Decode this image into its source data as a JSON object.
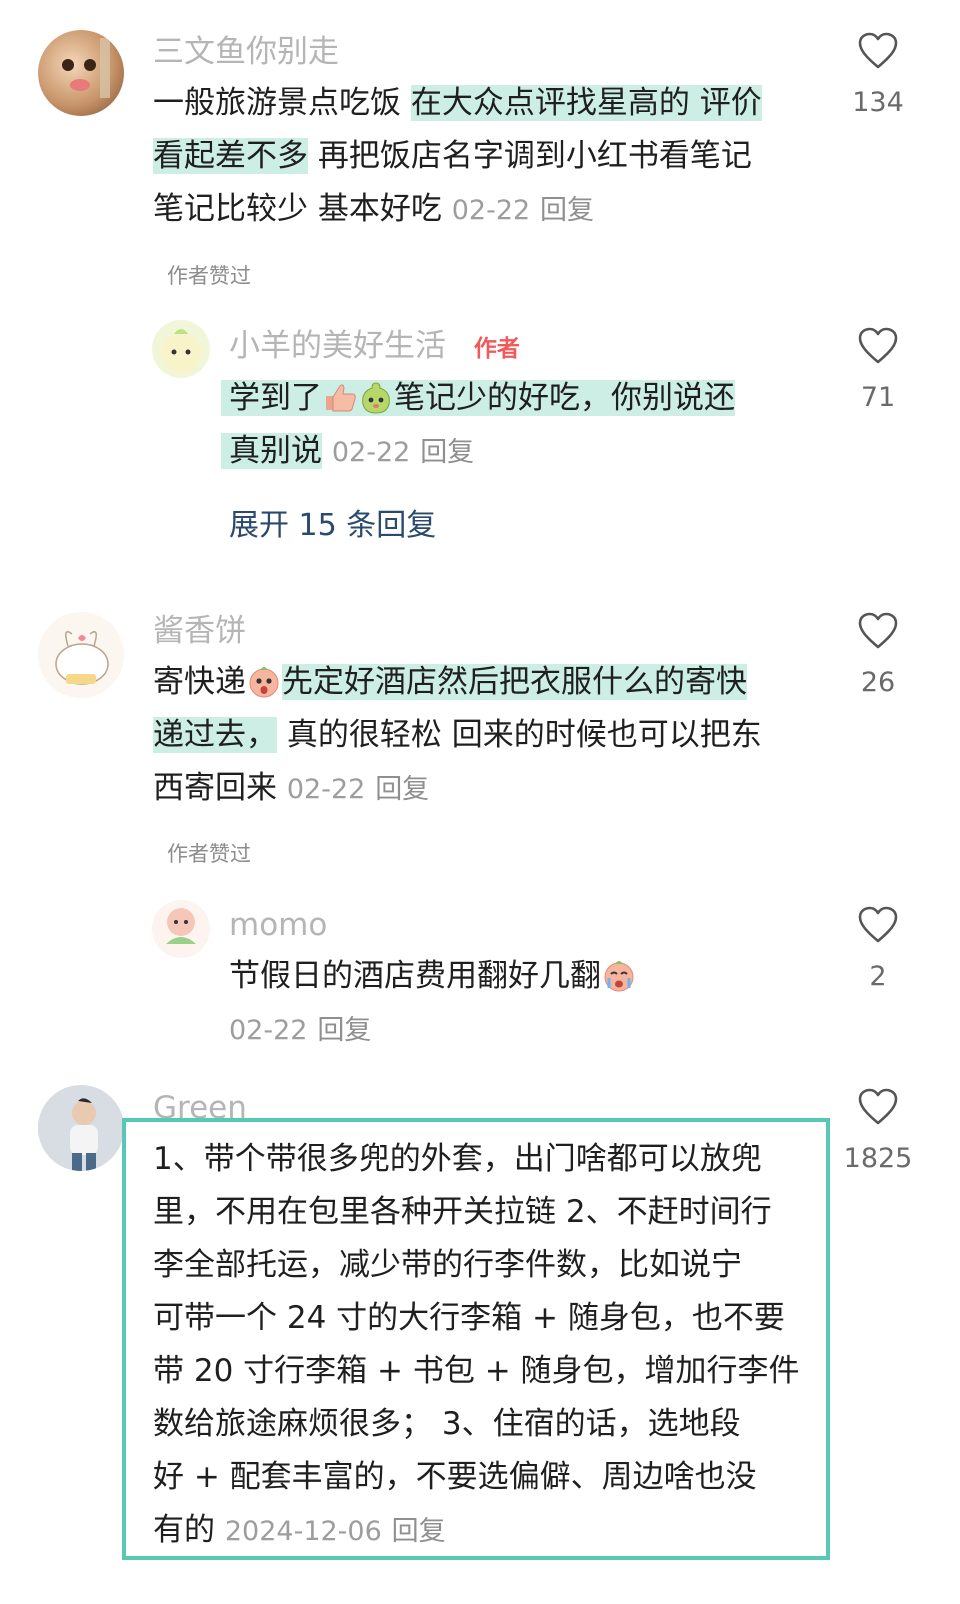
{
  "comments": [
    {
      "user": "三文鱼你别走",
      "text_parts": [
        "一般旅游景点吃饭 ",
        "在大众点评找星高的 评价看起差不多",
        " 再把饭店名字调到小红书看笔记笔记比较少 基本好吃"
      ],
      "line1_plain": "一般旅游景点吃饭 ",
      "line1_hl": "在大众点评找星高的 评价",
      "line2_hl": "看起差不多",
      "line2_plain": " 再把饭店名字调到小红书看笔记",
      "line3_plain": "笔记比较少 基本好吃",
      "date": "02-22",
      "reply_label": "回复",
      "liked_label": "作者赞过",
      "likes": "134"
    },
    {
      "user": "小羊的美好生活",
      "author_tag": "作者",
      "line1_a": "学到了",
      "line1_b": "笔记少的好吃，你别说还",
      "line2": "真别说",
      "date": "02-22",
      "reply_label": "回复",
      "likes": "71",
      "expand_label": "展开 15 条回复"
    },
    {
      "user": "酱香饼",
      "line1_plain": "寄快递",
      "line1_hl": "先定好酒店然后把衣服什么的寄快",
      "line2_hl": "递过去，",
      "line2_plain": " 真的很轻松 回来的时候也可以把东",
      "line3_plain": "西寄回来",
      "date": "02-22",
      "reply_label": "回复",
      "liked_label": "作者赞过",
      "likes": "26"
    },
    {
      "user": "momo",
      "line1": "节假日的酒店费用翻好几翻",
      "date": "02-22",
      "reply_label": "回复",
      "likes": "2"
    },
    {
      "user": "Green",
      "lines": [
        "1、带个带很多兜的外套，出门啥都可以放兜",
        "里，不用在包里各种开关拉链 2、不赶时间行",
        "李全部托运，减少带的行李件数，比如说宁",
        "可带一个 24 寸的大行李箱 + 随身包，也不要",
        "带 20 寸行李箱 + 书包 + 随身包，增加行李件",
        "数给旅途麻烦很多； 3、住宿的话，选地段",
        "好 + 配套丰富的，不要选偏僻、周边啥也没"
      ],
      "last_line": "有的",
      "date": "2024-12-06",
      "reply_label": "回复",
      "likes": "1825"
    }
  ],
  "colors": {
    "highlight": "#cdeee4",
    "box_border": "#56c8b5",
    "author_tag": "#f05a5a",
    "expand": "#2b4a6e"
  },
  "icons": [
    "heart-outline-icon",
    "thumbs-up-emoji",
    "pear-face-emoji",
    "crying-face-emoji"
  ]
}
